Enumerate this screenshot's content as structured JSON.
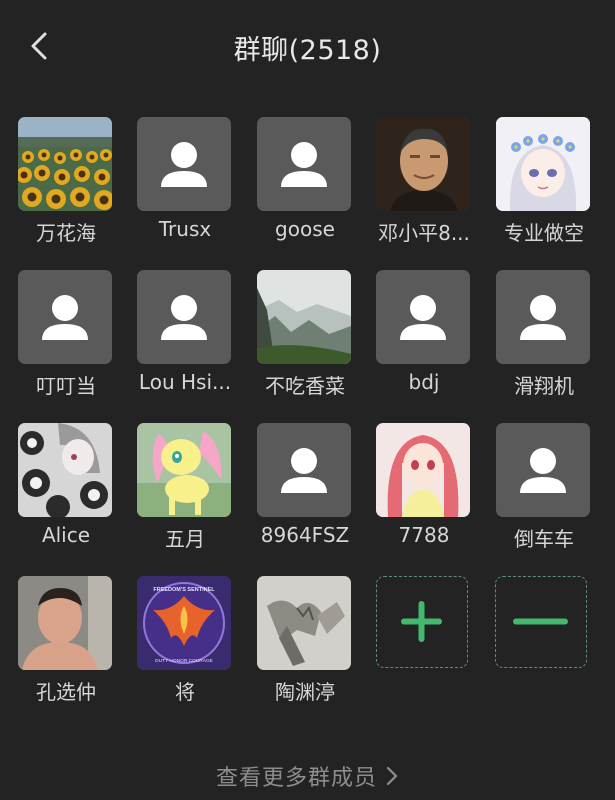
{
  "header": {
    "title": "群聊(2518)",
    "back_icon": "chevron-left-icon"
  },
  "members": [
    {
      "name": "万花海",
      "avatar": "sunflower-field-photo"
    },
    {
      "name": "Trusx",
      "avatar": "default-person-icon"
    },
    {
      "name": "goose",
      "avatar": "default-person-icon"
    },
    {
      "name": "邓小平8...",
      "avatar": "portrait-photo"
    },
    {
      "name": "专业做空",
      "avatar": "anime-girl-flower-crown"
    },
    {
      "name": "叮叮当",
      "avatar": "default-person-icon"
    },
    {
      "name": "Lou Hsi...",
      "avatar": "default-person-icon"
    },
    {
      "name": "不吃香菜",
      "avatar": "mountain-landscape-photo"
    },
    {
      "name": "bdj",
      "avatar": "default-person-icon"
    },
    {
      "name": "滑翔机",
      "avatar": "default-person-icon"
    },
    {
      "name": "Alice",
      "avatar": "anime-girl-flowers-monochrome"
    },
    {
      "name": "五月",
      "avatar": "yellow-pony-cartoon"
    },
    {
      "name": "8964FSZ",
      "avatar": "default-person-icon"
    },
    {
      "name": "7788",
      "avatar": "anime-girl-red-hair"
    },
    {
      "name": "倒车车",
      "avatar": "default-person-icon"
    },
    {
      "name": "孔选仲",
      "avatar": "person-photo"
    },
    {
      "name": "将",
      "avatar": "phoenix-emblem",
      "emblem_text": "FREEDOM'S SENTINEL",
      "emblem_subtext": "DUTY HONOR COURAGE"
    },
    {
      "name": "陶渊渟",
      "avatar": "statue-sculpture-photo"
    }
  ],
  "actions": {
    "add_icon": "plus-icon",
    "remove_icon": "minus-icon",
    "accent": "#43b96f"
  },
  "footer": {
    "more_label": "查看更多群成员",
    "icon": "chevron-right-icon"
  }
}
